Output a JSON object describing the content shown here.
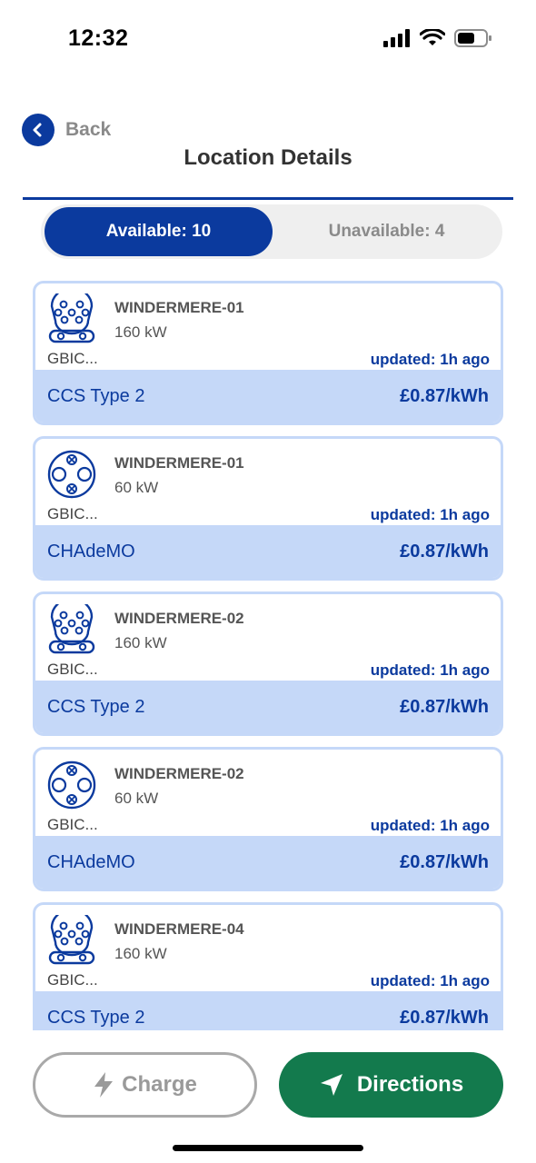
{
  "status_bar": {
    "time": "12:32"
  },
  "header": {
    "back_label": "Back",
    "title": "Location Details"
  },
  "tabs": {
    "available": "Available: 10",
    "unavailable": "Unavailable: 4"
  },
  "colors": {
    "accent": "#0b3a9e",
    "card_tint": "#c5d8f8",
    "directions": "#137a4d"
  },
  "chargers": [
    {
      "station": "WINDERMERE-01",
      "power": "160 kW",
      "operator": "GBIC...",
      "updated": "updated: 1h ago",
      "connector": "CCS Type 2",
      "price": "£0.87/kWh",
      "icon": "ccs-type2-icon"
    },
    {
      "station": "WINDERMERE-01",
      "power": "60 kW",
      "operator": "GBIC...",
      "updated": "updated: 1h ago",
      "connector": "CHAdeMO",
      "price": "£0.87/kWh",
      "icon": "chademo-icon"
    },
    {
      "station": "WINDERMERE-02",
      "power": "160 kW",
      "operator": "GBIC...",
      "updated": "updated: 1h ago",
      "connector": "CCS Type 2",
      "price": "£0.87/kWh",
      "icon": "ccs-type2-icon"
    },
    {
      "station": "WINDERMERE-02",
      "power": "60 kW",
      "operator": "GBIC...",
      "updated": "updated: 1h ago",
      "connector": "CHAdeMO",
      "price": "£0.87/kWh",
      "icon": "chademo-icon"
    },
    {
      "station": "WINDERMERE-04",
      "power": "160 kW",
      "operator": "GBIC...",
      "updated": "updated: 1h ago",
      "connector": "CCS Type 2",
      "price": "£0.87/kWh",
      "icon": "ccs-type2-icon"
    }
  ],
  "actions": {
    "charge_label": "Charge",
    "directions_label": "Directions"
  }
}
